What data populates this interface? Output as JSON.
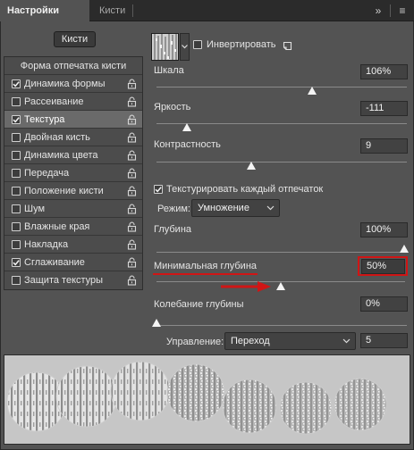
{
  "tabs": [
    {
      "label": "Настройки кисти"
    },
    {
      "label": "Кисти"
    }
  ],
  "tab_controls": {
    "collapse": "»",
    "menu": "≡"
  },
  "left": {
    "brushes_button": "Кисти",
    "options": [
      {
        "label": "Форма отпечатка кисти",
        "header": true
      },
      {
        "label": "Динамика формы",
        "checked": true
      },
      {
        "label": "Рассеивание",
        "checked": false
      },
      {
        "label": "Текстура",
        "checked": true,
        "selected": true
      },
      {
        "label": "Двойная кисть",
        "checked": false
      },
      {
        "label": "Динамика цвета",
        "checked": false
      },
      {
        "label": "Передача",
        "checked": false
      },
      {
        "label": "Положение кисти",
        "checked": false
      },
      {
        "label": "Шум",
        "checked": false
      },
      {
        "label": "Влажные края",
        "checked": false
      },
      {
        "label": "Накладка",
        "checked": false
      },
      {
        "label": "Сглаживание",
        "checked": true
      },
      {
        "label": "Защита текстуры",
        "checked": false
      }
    ]
  },
  "texture": {
    "invert_label": "Инвертировать",
    "invert_checked": false,
    "scale": {
      "label": "Шкала",
      "value": "106%",
      "level": 0.62
    },
    "brightness": {
      "label": "Яркость",
      "value": "-111",
      "level": 0.12
    },
    "contrast": {
      "label": "Контрастность",
      "value": "9",
      "level": 0.38
    },
    "texture_each_tip": {
      "label": "Текстурировать каждый отпечаток",
      "checked": true
    },
    "mode": {
      "label": "Режим:",
      "value": "Умножение"
    },
    "depth": {
      "label": "Глубина",
      "value": "100%",
      "level": 1.0
    },
    "min_depth": {
      "label": "Минимальная глубина",
      "value": "50%",
      "level": 0.5
    },
    "depth_jitter": {
      "label": "Колебание глубины",
      "value": "0%",
      "level": 0.0
    },
    "control": {
      "label": "Управление:",
      "value": "Переход",
      "number": "5"
    }
  },
  "colors": {
    "annotation": "#d01515",
    "panel": "#535353"
  }
}
